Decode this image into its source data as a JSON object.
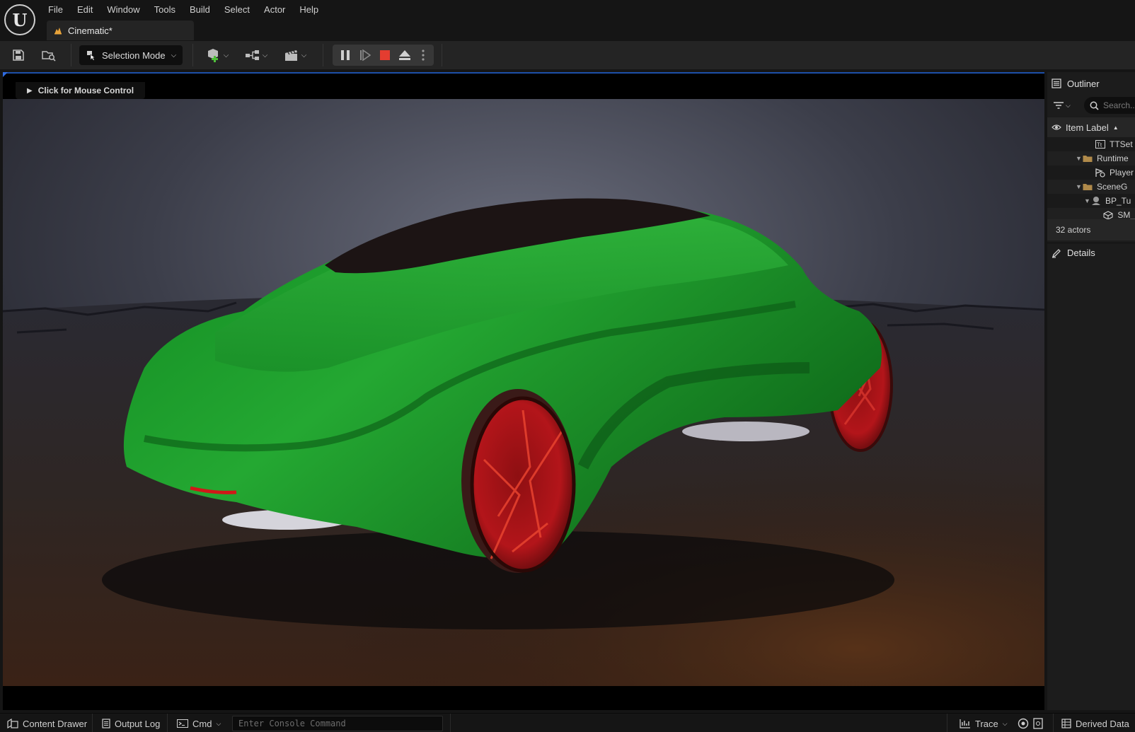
{
  "menubar": {
    "items": [
      "File",
      "Edit",
      "Window",
      "Tools",
      "Build",
      "Select",
      "Actor",
      "Help"
    ],
    "logo_icon": "unreal-engine-logo"
  },
  "document_tab": {
    "label": "Cinematic*",
    "icon": "level-icon",
    "icon_color": "#e8a33a"
  },
  "toolbar": {
    "selection_mode_label": "Selection Mode",
    "play_controls": [
      "pause",
      "step",
      "stop",
      "eject"
    ],
    "stop_color": "#e43d30"
  },
  "viewport": {
    "mouse_control_label": "Click for Mouse Control",
    "car_color": "#1f9a2a",
    "wheel_color": "#b3151a"
  },
  "outliner": {
    "tab_label": "Outliner",
    "search_placeholder": "Search...",
    "column_label": "Item Label",
    "rows": [
      {
        "label": "TTSet",
        "icon": "text-icon",
        "indent": 66,
        "expander": ""
      },
      {
        "label": "Runtime",
        "icon": "folder-icon",
        "indent": 44,
        "expander": "▼"
      },
      {
        "label": "Player",
        "icon": "player-start-icon",
        "indent": 66,
        "expander": ""
      },
      {
        "label": "SceneG",
        "icon": "folder-icon",
        "indent": 44,
        "expander": "▼"
      },
      {
        "label": "BP_Tu",
        "icon": "blueprint-icon",
        "indent": 56,
        "expander": "▼"
      },
      {
        "label": "SM_",
        "icon": "static-mesh-icon",
        "indent": 78,
        "expander": ""
      }
    ],
    "actor_count": "32 actors"
  },
  "details": {
    "tab_label": "Details"
  },
  "statusbar": {
    "content_drawer": "Content Drawer",
    "output_log": "Output Log",
    "cmd": "Cmd",
    "console_placeholder": "Enter Console Command",
    "trace": "Trace",
    "derived_data": "Derived Data"
  }
}
